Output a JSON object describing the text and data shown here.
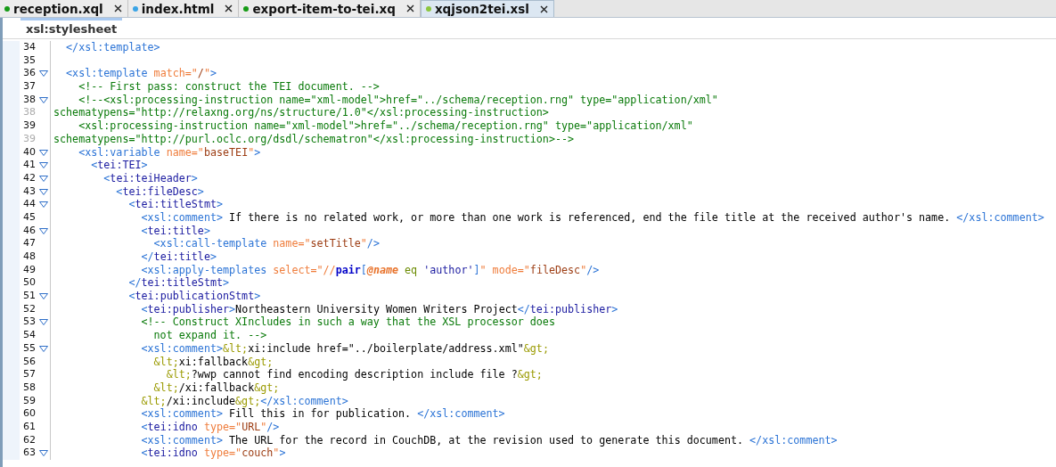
{
  "tabs": [
    {
      "label": "reception.xql",
      "color": "#159a15",
      "selected": false
    },
    {
      "label": "index.html",
      "color": "#3aa4e6",
      "selected": false
    },
    {
      "label": "export-item-to-tei.xq",
      "color": "#159a15",
      "selected": false
    },
    {
      "label": "xqjson2tei.xsl",
      "color": "#8cc63f",
      "selected": true
    }
  ],
  "breadcrumb": "xsl:stylesheet",
  "lines": [
    {
      "number": "34",
      "foldable": false,
      "continuation": false,
      "code": [
        {
          "kind": "xsl",
          "text": "  </xsl:template>"
        }
      ]
    },
    {
      "number": "35",
      "foldable": false,
      "continuation": false
    },
    {
      "number": "36",
      "foldable": true,
      "continuation": false,
      "code": [
        {
          "kind": "xsl",
          "text": "  <xsl:template "
        },
        {
          "kind": "attr",
          "text": "match=\""
        },
        {
          "kind": "value",
          "text": "/"
        },
        {
          "kind": "attr",
          "text": "\""
        },
        {
          "kind": "xsl",
          "text": ">"
        }
      ]
    },
    {
      "number": "37",
      "foldable": false,
      "continuation": false,
      "code": [
        {
          "kind": "comment",
          "text": "    <!-- First pass: construct the TEI document. -->"
        }
      ]
    },
    {
      "number": "38",
      "foldable": true,
      "continuation": false,
      "code": [
        {
          "kind": "comment",
          "text": "    <!--<xsl:processing-instruction name=\"xml-model\">href=\"../schema/reception.rng\" type=\"application/xml\""
        }
      ]
    },
    {
      "number": "38",
      "foldable": false,
      "continuation": true,
      "code": [
        {
          "kind": "comment",
          "text": "schematypens=\"http://relaxng.org/ns/structure/1.0\"</xsl:processing-instruction>"
        }
      ]
    },
    {
      "number": "39",
      "foldable": false,
      "continuation": false,
      "code": [
        {
          "kind": "comment",
          "text": "    <xsl:processing-instruction name=\"xml-model\">href=\"../schema/reception.rng\" type=\"application/xml\""
        }
      ]
    },
    {
      "number": "39",
      "foldable": false,
      "continuation": true,
      "code": [
        {
          "kind": "comment",
          "text": "schematypens=\"http://purl.oclc.org/dsdl/schematron\"</xsl:processing-instruction>-->"
        }
      ]
    },
    {
      "number": "40",
      "foldable": true,
      "continuation": false,
      "code": [
        {
          "kind": "xsl",
          "text": "    <xsl:variable "
        },
        {
          "kind": "attr",
          "text": "name=\""
        },
        {
          "kind": "value",
          "text": "baseTEI"
        },
        {
          "kind": "attr",
          "text": "\""
        },
        {
          "kind": "xsl",
          "text": ">"
        }
      ]
    },
    {
      "number": "41",
      "foldable": true,
      "continuation": false,
      "code": [
        {
          "kind": "xsl",
          "text": "      <"
        },
        {
          "kind": "tei",
          "text": "tei:TEI"
        },
        {
          "kind": "xsl",
          "text": ">"
        }
      ]
    },
    {
      "number": "42",
      "foldable": true,
      "continuation": false,
      "code": [
        {
          "kind": "xsl",
          "text": "        <"
        },
        {
          "kind": "tei",
          "text": "tei:teiHeader"
        },
        {
          "kind": "xsl",
          "text": ">"
        }
      ]
    },
    {
      "number": "43",
      "foldable": true,
      "continuation": false,
      "code": [
        {
          "kind": "xsl",
          "text": "          <"
        },
        {
          "kind": "tei",
          "text": "tei:fileDesc"
        },
        {
          "kind": "xsl",
          "text": ">"
        }
      ]
    },
    {
      "number": "44",
      "foldable": true,
      "continuation": false,
      "code": [
        {
          "kind": "xsl",
          "text": "            <"
        },
        {
          "kind": "tei",
          "text": "tei:titleStmt"
        },
        {
          "kind": "xsl",
          "text": ">"
        }
      ]
    },
    {
      "number": "45",
      "foldable": false,
      "continuation": false,
      "code": [
        {
          "kind": "xsl",
          "text": "              <xsl:comment>"
        },
        {
          "kind": "plain",
          "text": " If there is no related work, or more than one work is referenced, end the file title at the received author's name. "
        },
        {
          "kind": "xsl",
          "text": "</xsl:comment>"
        }
      ]
    },
    {
      "number": "46",
      "foldable": true,
      "continuation": false,
      "code": [
        {
          "kind": "xsl",
          "text": "              <"
        },
        {
          "kind": "tei",
          "text": "tei:title"
        },
        {
          "kind": "xsl",
          "text": ">"
        }
      ]
    },
    {
      "number": "47",
      "foldable": false,
      "continuation": false,
      "code": [
        {
          "kind": "xsl",
          "text": "                <xsl:call-template "
        },
        {
          "kind": "attr",
          "text": "name=\""
        },
        {
          "kind": "value",
          "text": "setTitle"
        },
        {
          "kind": "attr",
          "text": "\""
        },
        {
          "kind": "xsl",
          "text": "/>"
        }
      ]
    },
    {
      "number": "48",
      "foldable": false,
      "continuation": false,
      "code": [
        {
          "kind": "xsl",
          "text": "              </"
        },
        {
          "kind": "tei",
          "text": "tei:title"
        },
        {
          "kind": "xsl",
          "text": ">"
        }
      ]
    },
    {
      "number": "49",
      "foldable": false,
      "continuation": false,
      "code": [
        {
          "kind": "xsl",
          "text": "              <xsl:apply-templates "
        },
        {
          "kind": "attr",
          "text": "select=\"//"
        },
        {
          "kind": "function",
          "text": "pair"
        },
        {
          "kind": "punct",
          "text": "["
        },
        {
          "kind": "xattr",
          "text": "@name"
        },
        {
          "kind": "operator",
          "text": " eq "
        },
        {
          "kind": "string",
          "text": "'author'"
        },
        {
          "kind": "punct",
          "text": "]"
        },
        {
          "kind": "attr",
          "text": "\" mode=\""
        },
        {
          "kind": "value",
          "text": "fileDesc"
        },
        {
          "kind": "attr",
          "text": "\""
        },
        {
          "kind": "xsl",
          "text": "/>"
        }
      ]
    },
    {
      "number": "50",
      "foldable": false,
      "continuation": false,
      "code": [
        {
          "kind": "xsl",
          "text": "            </"
        },
        {
          "kind": "tei",
          "text": "tei:titleStmt"
        },
        {
          "kind": "xsl",
          "text": ">"
        }
      ]
    },
    {
      "number": "51",
      "foldable": true,
      "continuation": false,
      "code": [
        {
          "kind": "xsl",
          "text": "            <"
        },
        {
          "kind": "tei",
          "text": "tei:publicationStmt"
        },
        {
          "kind": "xsl",
          "text": ">"
        }
      ]
    },
    {
      "number": "52",
      "foldable": false,
      "continuation": false,
      "code": [
        {
          "kind": "xsl",
          "text": "              <"
        },
        {
          "kind": "tei",
          "text": "tei:publisher"
        },
        {
          "kind": "xsl",
          "text": ">"
        },
        {
          "kind": "plain",
          "text": "Northeastern University Women Writers Project"
        },
        {
          "kind": "xsl",
          "text": "</"
        },
        {
          "kind": "tei",
          "text": "tei:publisher"
        },
        {
          "kind": "xsl",
          "text": ">"
        }
      ]
    },
    {
      "number": "53",
      "foldable": true,
      "continuation": false,
      "code": [
        {
          "kind": "comment",
          "text": "              <!-- Construct XIncludes in such a way that the XSL processor does"
        }
      ]
    },
    {
      "number": "54",
      "foldable": false,
      "continuation": false,
      "code": [
        {
          "kind": "comment",
          "text": "                not expand it. -->"
        }
      ]
    },
    {
      "number": "55",
      "foldable": true,
      "continuation": false,
      "code": [
        {
          "kind": "xsl",
          "text": "              <xsl:comment>"
        },
        {
          "kind": "entity",
          "text": "&lt;"
        },
        {
          "kind": "plain",
          "text": "xi:include href=\"../boilerplate/address.xml\""
        },
        {
          "kind": "entity",
          "text": "&gt;"
        }
      ]
    },
    {
      "number": "56",
      "foldable": false,
      "continuation": false,
      "code": [
        {
          "kind": "entity",
          "text": "                &lt;"
        },
        {
          "kind": "plain",
          "text": "xi:fallback"
        },
        {
          "kind": "entity",
          "text": "&gt;"
        }
      ]
    },
    {
      "number": "57",
      "foldable": false,
      "continuation": false,
      "code": [
        {
          "kind": "entity",
          "text": "                  &lt;"
        },
        {
          "kind": "plain",
          "text": "?wwp cannot find encoding description include file ?"
        },
        {
          "kind": "entity",
          "text": "&gt;"
        }
      ]
    },
    {
      "number": "58",
      "foldable": false,
      "continuation": false,
      "code": [
        {
          "kind": "entity",
          "text": "                &lt;"
        },
        {
          "kind": "plain",
          "text": "/xi:fallback"
        },
        {
          "kind": "entity",
          "text": "&gt;"
        }
      ]
    },
    {
      "number": "59",
      "foldable": false,
      "continuation": false,
      "code": [
        {
          "kind": "entity",
          "text": "              &lt;"
        },
        {
          "kind": "plain",
          "text": "/xi:include"
        },
        {
          "kind": "entity",
          "text": "&gt;"
        },
        {
          "kind": "xsl",
          "text": "</xsl:comment>"
        }
      ]
    },
    {
      "number": "60",
      "foldable": false,
      "continuation": false,
      "code": [
        {
          "kind": "xsl",
          "text": "              <xsl:comment>"
        },
        {
          "kind": "plain",
          "text": " Fill this in for publication. "
        },
        {
          "kind": "xsl",
          "text": "</xsl:comment>"
        }
      ]
    },
    {
      "number": "61",
      "foldable": false,
      "continuation": false,
      "code": [
        {
          "kind": "xsl",
          "text": "              <"
        },
        {
          "kind": "tei",
          "text": "tei:idno "
        },
        {
          "kind": "attr",
          "text": "type=\""
        },
        {
          "kind": "value",
          "text": "URL"
        },
        {
          "kind": "attr",
          "text": "\""
        },
        {
          "kind": "xsl",
          "text": "/>"
        }
      ]
    },
    {
      "number": "62",
      "foldable": false,
      "continuation": false,
      "code": [
        {
          "kind": "xsl",
          "text": "              <xsl:comment>"
        },
        {
          "kind": "plain",
          "text": " The URL for the record in CouchDB, at the revision used to generate this document. "
        },
        {
          "kind": "xsl",
          "text": "</xsl:comment>"
        }
      ]
    },
    {
      "number": "63",
      "foldable": true,
      "continuation": false,
      "code": [
        {
          "kind": "xsl",
          "text": "              <"
        },
        {
          "kind": "tei",
          "text": "tei:idno "
        },
        {
          "kind": "attr",
          "text": "type=\""
        },
        {
          "kind": "value",
          "text": "couch"
        },
        {
          "kind": "attr",
          "text": "\""
        },
        {
          "kind": "xsl",
          "text": ">"
        }
      ]
    }
  ]
}
